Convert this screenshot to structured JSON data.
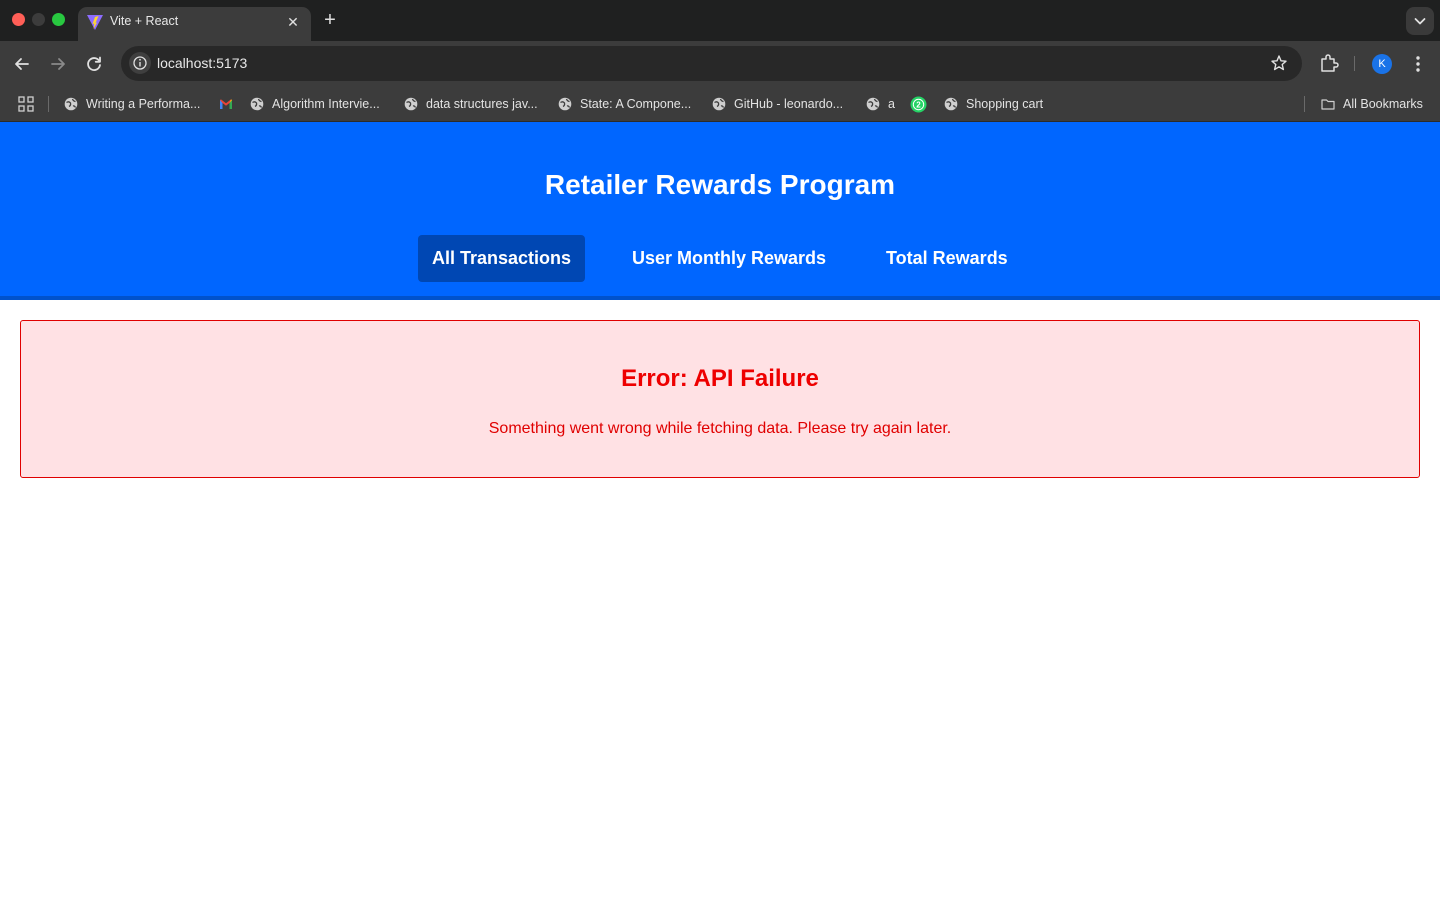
{
  "browser": {
    "tab": {
      "title": "Vite + React",
      "favicon": "vite-logo-icon",
      "close_icon": "close-icon"
    },
    "new_tab_label": "+",
    "address_bar": {
      "url": "localhost:5173",
      "info_icon": "info-icon"
    },
    "profile_initial": "K",
    "bookmarks": [
      {
        "label": "Writing a Performa...",
        "icon": "globe-icon"
      },
      {
        "label": "",
        "icon": "gmail-icon"
      },
      {
        "label": "Algorithm Intervie...",
        "icon": "globe-icon"
      },
      {
        "label": "data structures jav...",
        "icon": "globe-icon"
      },
      {
        "label": "State: A Compone...",
        "icon": "globe-icon"
      },
      {
        "label": "GitHub - leonardo...",
        "icon": "globe-icon"
      },
      {
        "label": "a",
        "icon": "globe-icon"
      },
      {
        "label": "",
        "icon": "whatsapp-icon",
        "badge": "2"
      },
      {
        "label": "Shopping cart",
        "icon": "globe-icon"
      }
    ],
    "all_bookmarks_label": "All Bookmarks"
  },
  "app": {
    "title": "Retailer Rewards Program",
    "nav": [
      {
        "label": "All Transactions",
        "active": true
      },
      {
        "label": "User Monthly Rewards",
        "active": false
      },
      {
        "label": "Total Rewards",
        "active": false
      }
    ],
    "error": {
      "title": "Error: API Failure",
      "message": "Something went wrong while fetching data. Please try again later."
    }
  },
  "colors": {
    "header_bg": "#0066ff",
    "active_tab_bg": "#0047b3",
    "error_bg": "#ffe1e4",
    "error_text": "#ee0000",
    "browser_chrome": "#3c3c3c"
  }
}
